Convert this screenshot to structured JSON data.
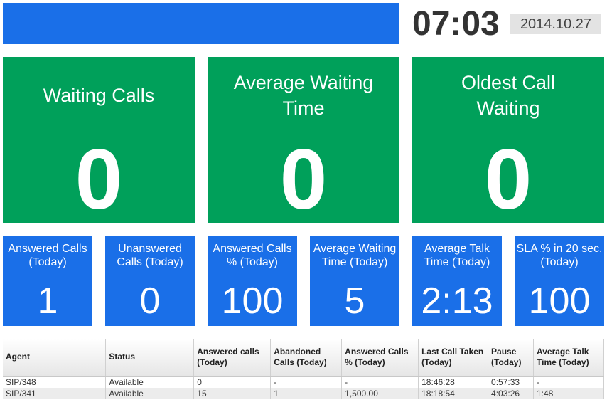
{
  "header": {
    "time": "07:03",
    "date": "2014.10.27",
    "bar_color": "#1a6fe8"
  },
  "colors": {
    "green_tile": "#00a05a",
    "blue_tile": "#1a6fe8"
  },
  "big_tiles": [
    {
      "label": "Waiting Calls",
      "value": "0"
    },
    {
      "label": "Average Waiting Time",
      "value": "0"
    },
    {
      "label": "Oldest Call Waiting",
      "value": "0"
    }
  ],
  "small_tiles": [
    {
      "label": "Answered Calls (Today)",
      "value": "1"
    },
    {
      "label": "Unanswered Calls (Today)",
      "value": "0"
    },
    {
      "label": "Answered Calls % (Today)",
      "value": "100"
    },
    {
      "label": "Average Waiting Time (Today)",
      "value": "5"
    },
    {
      "label": "Average Talk Time (Today)",
      "value": "2:13"
    },
    {
      "label": "SLA % in 20 sec. (Today)",
      "value": "100"
    }
  ],
  "table": {
    "columns": [
      "Agent",
      "Status",
      "Answered calls (Today)",
      "Abandoned Calls (Today)",
      "Answered Calls % (Today)",
      "Last Call Taken (Today)",
      "Pause (Today)",
      "Average Talk Time (Today)"
    ],
    "rows": [
      [
        "SIP/348",
        "Available",
        "0",
        "-",
        "-",
        "18:46:28",
        "0:57:33",
        "-"
      ],
      [
        "SIP/341",
        "Available",
        "15",
        "1",
        "1,500.00",
        "18:18:54",
        "4:03:26",
        "1:48"
      ]
    ]
  }
}
